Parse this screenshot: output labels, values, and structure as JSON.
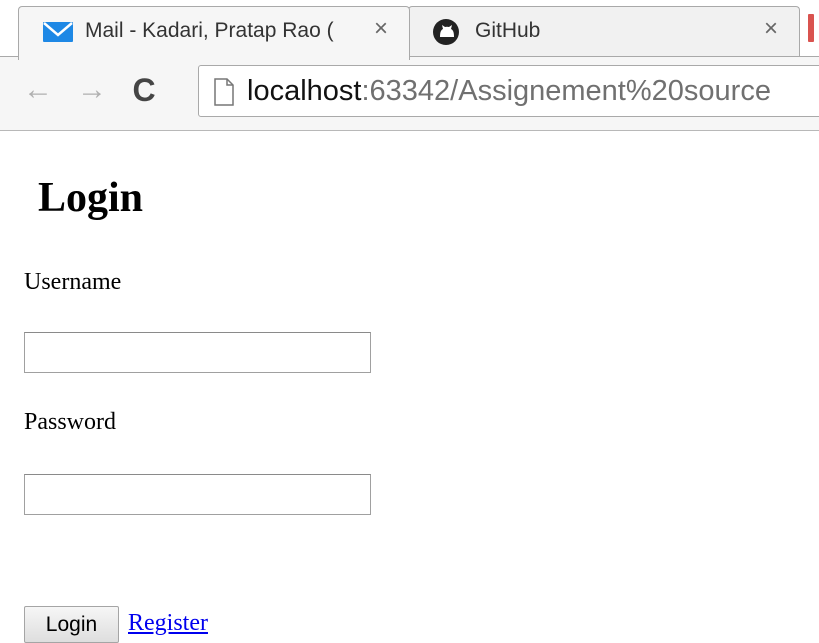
{
  "browser": {
    "tabs": [
      {
        "title": "Mail - Kadari, Pratap Rao (",
        "icon": "mail-icon"
      },
      {
        "title": "GitHub",
        "icon": "github-icon"
      }
    ],
    "close_glyph": "×",
    "address_host": "localhost",
    "address_rest": ":63342/Assignement%20source",
    "back_glyph": "←",
    "forward_glyph": "→",
    "reload_glyph": "C"
  },
  "page": {
    "heading": "Login",
    "username_label": "Username",
    "username_value": "",
    "password_label": "Password",
    "password_value": "",
    "login_button": "Login",
    "register_link": "Register"
  },
  "colors": {
    "link": "#0000ee",
    "mail_icon": "#1e88e5",
    "tab_edge": "#d9534f"
  }
}
